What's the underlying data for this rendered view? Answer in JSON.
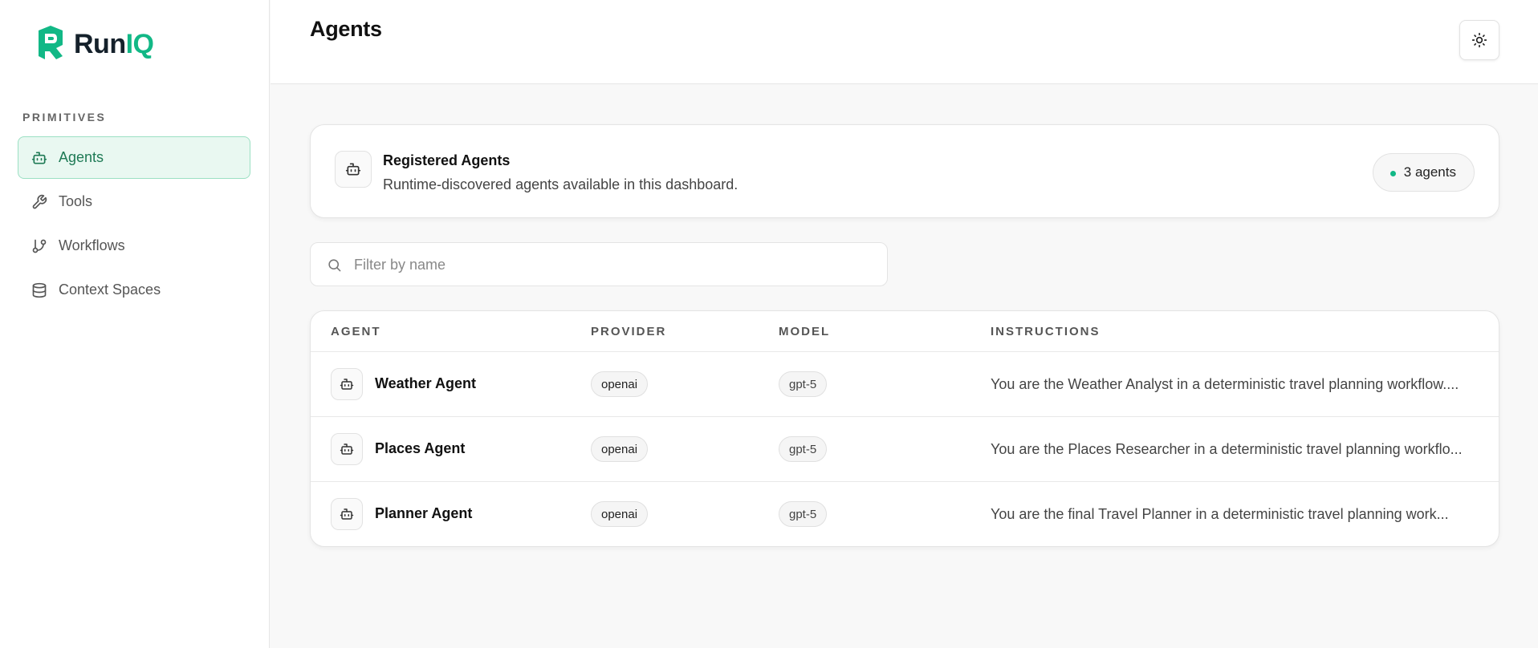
{
  "app": {
    "name_part1": "Run",
    "name_part2": "IQ",
    "brand_color": "#12b886"
  },
  "sidebar": {
    "section_label": "PRIMITIVES",
    "items": [
      {
        "label": "Agents",
        "icon": "bot-icon",
        "active": true
      },
      {
        "label": "Tools",
        "icon": "wrench-icon",
        "active": false
      },
      {
        "label": "Workflows",
        "icon": "git-branch-icon",
        "active": false
      },
      {
        "label": "Context Spaces",
        "icon": "database-icon",
        "active": false
      }
    ]
  },
  "header": {
    "title": "Agents",
    "theme_icon": "sun-icon"
  },
  "info_card": {
    "title": "Registered Agents",
    "subtitle": "Runtime-discovered agents available in this dashboard.",
    "count_label": "3 agents"
  },
  "search": {
    "placeholder": "Filter by name",
    "value": ""
  },
  "table": {
    "columns": [
      "AGENT",
      "PROVIDER",
      "MODEL",
      "INSTRUCTIONS"
    ],
    "rows": [
      {
        "agent": "Weather Agent",
        "provider": "openai",
        "model": "gpt-5",
        "instructions": "You are the Weather Analyst in a deterministic travel planning workflow...."
      },
      {
        "agent": "Places Agent",
        "provider": "openai",
        "model": "gpt-5",
        "instructions": "You are the Places Researcher in a deterministic travel planning workflo..."
      },
      {
        "agent": "Planner Agent",
        "provider": "openai",
        "model": "gpt-5",
        "instructions": "You are the final Travel Planner in a deterministic travel planning work..."
      }
    ]
  }
}
